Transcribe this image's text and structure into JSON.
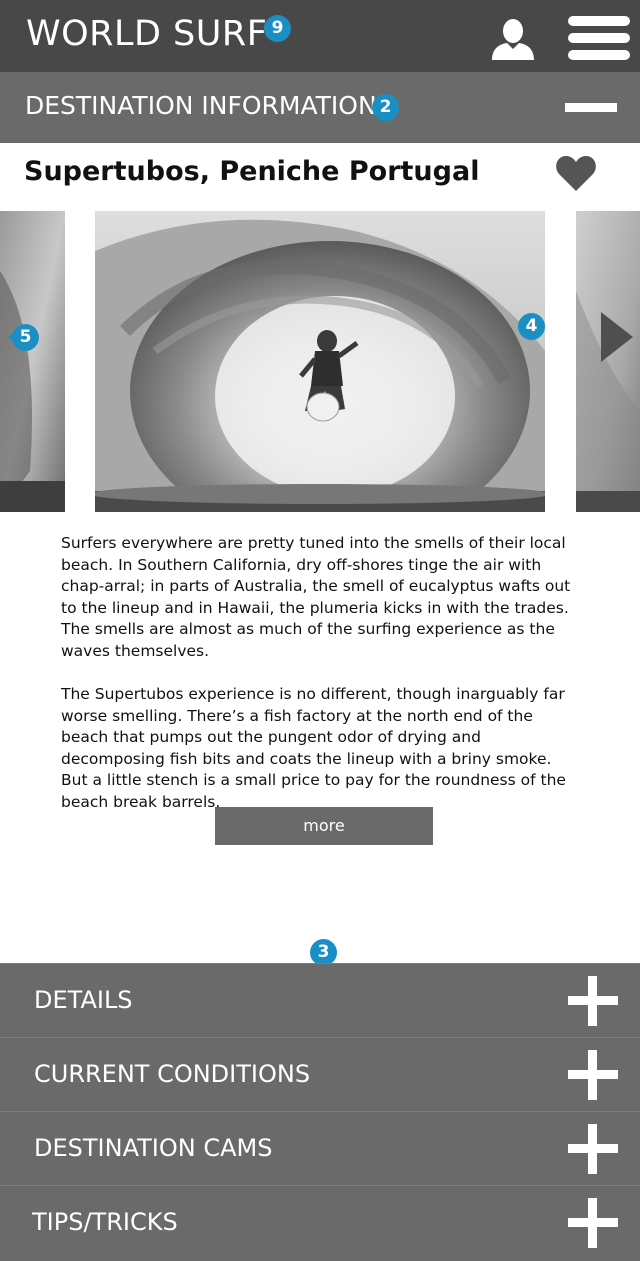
{
  "header": {
    "app_title": "WORLD SURF",
    "badge": "9",
    "user_icon": "user-icon",
    "menu_icon": "hamburger-menu-icon"
  },
  "section": {
    "title": "DESTINATION INFORMATION",
    "badge": "2",
    "collapse_icon": "minus-icon"
  },
  "destination": {
    "title": "Supertubos, Peniche Portugal",
    "favorite_icon": "heart-icon"
  },
  "carousel": {
    "prev_badge": "5",
    "main_badge": "4",
    "next_icon": "chevron-right-icon"
  },
  "description": {
    "paragraphs": [
      "Surfers everywhere are pretty tuned into the smells of their local beach. In Southern California, dry off-shores tinge the air with chap-arral; in parts of Australia, the smell of eucalyptus wafts out to the lineup and in Hawaii, the plumeria kicks in with the trades. The smells are almost as much of the surfing experience as the waves themselves.",
      "The Supertubos experience is no different, though inarguably far worse smelling. There’s a fish factory at the north end of the beach that pumps out the pungent odor of drying and decomposing fish bits and coats the lineup with a briny smoke. But a little stench is a small price to pay for the roundness of the beach break barrels."
    ],
    "more_label": "more"
  },
  "accordion": {
    "badge": "3",
    "items": [
      {
        "label": "DETAILS"
      },
      {
        "label": "CURRENT CONDITIONS"
      },
      {
        "label": "DESTINATION CAMS"
      },
      {
        "label": "TIPS/TRICKS"
      }
    ]
  },
  "colors": {
    "header_bg": "#484848",
    "panel_bg": "#6a6a6a",
    "badge": "#1a8fc4"
  }
}
